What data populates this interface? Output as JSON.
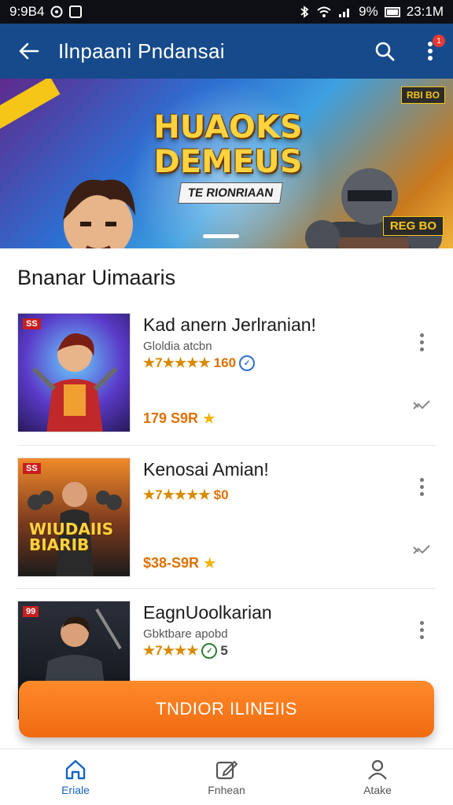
{
  "status_bar": {
    "time_left": "9:9B4",
    "battery_pct": "9%",
    "time_right": "23:1M"
  },
  "app_bar": {
    "title": "Ilnpaani Pndansai",
    "notification_count": "1"
  },
  "banner": {
    "title": "HUAOKS DEMEUS",
    "subtitle": "TE RIONRIAAN",
    "tag_top": "RBI BO",
    "badge_bottom": "REG BO"
  },
  "section": {
    "title": "Bnanar Uimaaris"
  },
  "games": [
    {
      "name": "Kad anern Jerlranian!",
      "subtitle": "Gloldia atcbn",
      "rating_text": "★7★★★★",
      "rating_count": "160",
      "price": "179 S9R",
      "thumb_tag": "SS"
    },
    {
      "name": "Kenosai Amian!",
      "subtitle": "",
      "rating_text": "★7★★★★",
      "rating_count": "$0",
      "price": "$38-S9R",
      "thumb_tag": "SS",
      "thumb_logo": "WIUDAIIS BIARIB"
    },
    {
      "name": "EagnUoolkarian",
      "subtitle": "Gbktbare apobd",
      "rating_text": "★7★★★",
      "rating_count": "5",
      "price": "",
      "thumb_tag": "99"
    }
  ],
  "cta": {
    "label": "TNDIOR ILINEIIS"
  },
  "bottom_nav": {
    "items": [
      {
        "label": "Eriale",
        "icon": "home-icon"
      },
      {
        "label": "Fnhean",
        "icon": "compose-icon"
      },
      {
        "label": "Atake",
        "icon": "profile-icon"
      }
    ]
  },
  "colors": {
    "app_bar": "#174a8b",
    "accent": "#f06a0f",
    "active_nav": "#1565c0"
  }
}
